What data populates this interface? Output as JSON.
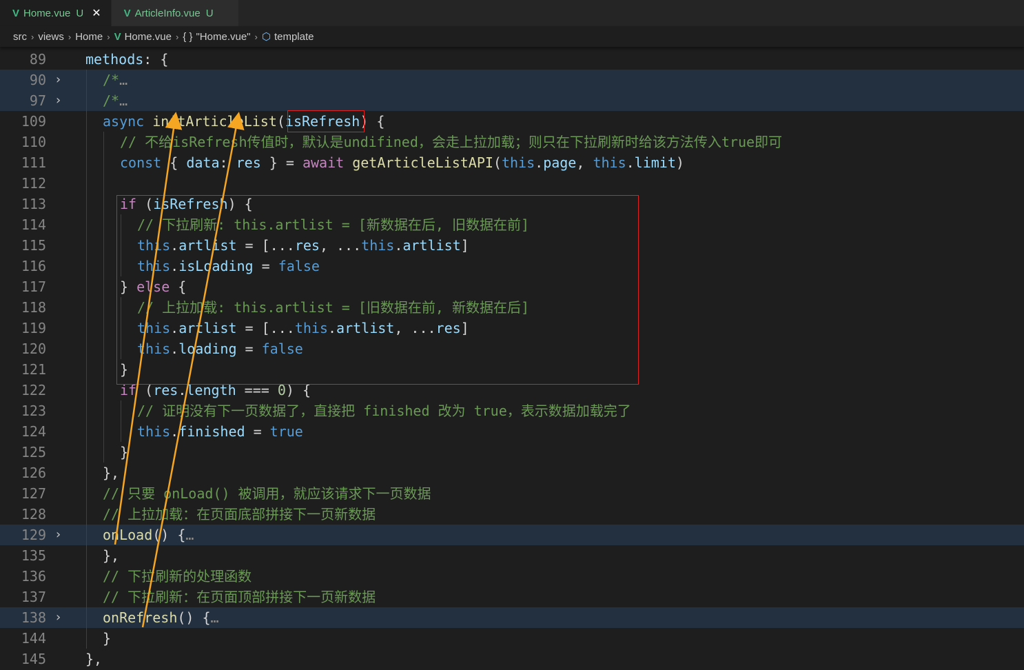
{
  "tabs": [
    {
      "name": "Home.vue",
      "badge": "U",
      "close": "✕",
      "active": true
    },
    {
      "name": "ArticleInfo.vue",
      "badge": "U",
      "active": false
    }
  ],
  "breadcrumb": {
    "items": [
      "src",
      "views",
      "Home",
      "Home.vue",
      "\"Home.vue\"",
      "template"
    ],
    "separator": "›"
  },
  "colors": {
    "vue_icon": "#41b883",
    "annotation_box": "#e02020",
    "annotation_arrow": "#f5a623",
    "line_highlight": "#233040"
  },
  "code_lines": [
    {
      "ln": "89",
      "indent": 0,
      "tokens": [
        [
          "pr",
          "methods"
        ],
        [
          "",
          ": {"
        ]
      ]
    },
    {
      "ln": "90",
      "indent": 1,
      "fold": "›",
      "hl": true,
      "tokens": [
        [
          "cm",
          "/*"
        ],
        [
          "fold-dots",
          "…"
        ]
      ]
    },
    {
      "ln": "97",
      "indent": 1,
      "fold": "›",
      "hl": true,
      "tokens": [
        [
          "cm",
          "/*"
        ],
        [
          "fold-dots",
          "…"
        ]
      ]
    },
    {
      "ln": "109",
      "indent": 1,
      "tokens": [
        [
          "kw",
          "async"
        ],
        [
          "",
          " "
        ],
        [
          "fn",
          "initArticleList"
        ],
        [
          "",
          "("
        ],
        [
          "pr",
          "isRefresh"
        ],
        [
          "",
          ") {"
        ]
      ]
    },
    {
      "ln": "110",
      "indent": 2,
      "tokens": [
        [
          "cm",
          "// 不给isRefresh传值时，默认是undifined，会走上拉加载；则只在下拉刷新时给该方法传入true即可"
        ]
      ]
    },
    {
      "ln": "111",
      "indent": 2,
      "tokens": [
        [
          "kw",
          "const"
        ],
        [
          "",
          " { "
        ],
        [
          "pr",
          "data"
        ],
        [
          "",
          ": "
        ],
        [
          "pr",
          "res"
        ],
        [
          "",
          " } = "
        ],
        [
          "ctl",
          "await"
        ],
        [
          "",
          " "
        ],
        [
          "fn",
          "getArticleListAPI"
        ],
        [
          "",
          "("
        ],
        [
          "kw",
          "this"
        ],
        [
          "",
          "."
        ],
        [
          "pr",
          "page"
        ],
        [
          "",
          ", "
        ],
        [
          "kw",
          "this"
        ],
        [
          "",
          "."
        ],
        [
          "pr",
          "limit"
        ],
        [
          "",
          ")"
        ]
      ]
    },
    {
      "ln": "112",
      "indent": 2,
      "tokens": []
    },
    {
      "ln": "113",
      "indent": 2,
      "tokens": [
        [
          "ctl",
          "if"
        ],
        [
          "",
          " ("
        ],
        [
          "pr",
          "isRefresh"
        ],
        [
          "",
          ") {"
        ]
      ]
    },
    {
      "ln": "114",
      "indent": 3,
      "tokens": [
        [
          "cm",
          "// 下拉刷新: this.artlist = [新数据在后, 旧数据在前]"
        ]
      ]
    },
    {
      "ln": "115",
      "indent": 3,
      "tokens": [
        [
          "kw",
          "this"
        ],
        [
          "",
          "."
        ],
        [
          "pr",
          "artlist"
        ],
        [
          "",
          " = [..."
        ],
        [
          "pr",
          "res"
        ],
        [
          "",
          ", ..."
        ],
        [
          "kw",
          "this"
        ],
        [
          "",
          "."
        ],
        [
          "pr",
          "artlist"
        ],
        [
          "",
          "]"
        ]
      ]
    },
    {
      "ln": "116",
      "indent": 3,
      "tokens": [
        [
          "kw",
          "this"
        ],
        [
          "",
          "."
        ],
        [
          "pr",
          "isLoading"
        ],
        [
          "",
          " = "
        ],
        [
          "kw",
          "false"
        ]
      ]
    },
    {
      "ln": "117",
      "indent": 2,
      "tokens": [
        [
          "",
          "} "
        ],
        [
          "ctl",
          "else"
        ],
        [
          "",
          " {"
        ]
      ]
    },
    {
      "ln": "118",
      "indent": 3,
      "tokens": [
        [
          "cm",
          "// 上拉加载: this.artlist = [旧数据在前, 新数据在后]"
        ]
      ]
    },
    {
      "ln": "119",
      "indent": 3,
      "tokens": [
        [
          "kw",
          "this"
        ],
        [
          "",
          "."
        ],
        [
          "pr",
          "artlist"
        ],
        [
          "",
          " = [..."
        ],
        [
          "kw",
          "this"
        ],
        [
          "",
          "."
        ],
        [
          "pr",
          "artlist"
        ],
        [
          "",
          ", ..."
        ],
        [
          "pr",
          "res"
        ],
        [
          "",
          "]"
        ]
      ]
    },
    {
      "ln": "120",
      "indent": 3,
      "tokens": [
        [
          "kw",
          "this"
        ],
        [
          "",
          "."
        ],
        [
          "pr",
          "loading"
        ],
        [
          "",
          " = "
        ],
        [
          "kw",
          "false"
        ]
      ]
    },
    {
      "ln": "121",
      "indent": 2,
      "tokens": [
        [
          "",
          "}"
        ]
      ]
    },
    {
      "ln": "122",
      "indent": 2,
      "tokens": [
        [
          "ctl",
          "if"
        ],
        [
          "",
          " ("
        ],
        [
          "pr",
          "res"
        ],
        [
          "",
          "."
        ],
        [
          "pr",
          "length"
        ],
        [
          "",
          " === "
        ],
        [
          "num",
          "0"
        ],
        [
          "",
          ") {"
        ]
      ]
    },
    {
      "ln": "123",
      "indent": 3,
      "tokens": [
        [
          "cm",
          "// 证明没有下一页数据了，直接把 finished 改为 true，表示数据加载完了"
        ]
      ]
    },
    {
      "ln": "124",
      "indent": 3,
      "tokens": [
        [
          "kw",
          "this"
        ],
        [
          "",
          "."
        ],
        [
          "pr",
          "finished"
        ],
        [
          "",
          " = "
        ],
        [
          "kw",
          "true"
        ]
      ]
    },
    {
      "ln": "125",
      "indent": 2,
      "tokens": [
        [
          "",
          "}"
        ]
      ]
    },
    {
      "ln": "126",
      "indent": 1,
      "tokens": [
        [
          "",
          "},"
        ]
      ]
    },
    {
      "ln": "127",
      "indent": 1,
      "tokens": [
        [
          "cm",
          "// 只要 onLoad() 被调用，就应该请求下一页数据"
        ]
      ]
    },
    {
      "ln": "128",
      "indent": 1,
      "tokens": [
        [
          "cm",
          "// 上拉加载：在页面底部拼接下一页新数据"
        ]
      ]
    },
    {
      "ln": "129",
      "indent": 1,
      "fold": "›",
      "hl": true,
      "tokens": [
        [
          "fn",
          "onLoad"
        ],
        [
          "",
          "() {"
        ],
        [
          "fold-dots",
          "…"
        ]
      ]
    },
    {
      "ln": "135",
      "indent": 1,
      "tokens": [
        [
          "",
          "},"
        ]
      ]
    },
    {
      "ln": "136",
      "indent": 1,
      "tokens": [
        [
          "cm",
          "// 下拉刷新的处理函数"
        ]
      ]
    },
    {
      "ln": "137",
      "indent": 1,
      "tokens": [
        [
          "cm",
          "// 下拉刷新：在页面顶部拼接下一页新数据"
        ]
      ]
    },
    {
      "ln": "138",
      "indent": 1,
      "fold": "›",
      "hl": true,
      "tokens": [
        [
          "fn",
          "onRefresh"
        ],
        [
          "",
          "() {"
        ],
        [
          "fold-dots",
          "…"
        ]
      ]
    },
    {
      "ln": "144",
      "indent": 1,
      "tokens": [
        [
          "",
          "}"
        ]
      ]
    },
    {
      "ln": "145",
      "indent": 0,
      "tokens": [
        [
          "",
          "},"
        ]
      ]
    }
  ]
}
